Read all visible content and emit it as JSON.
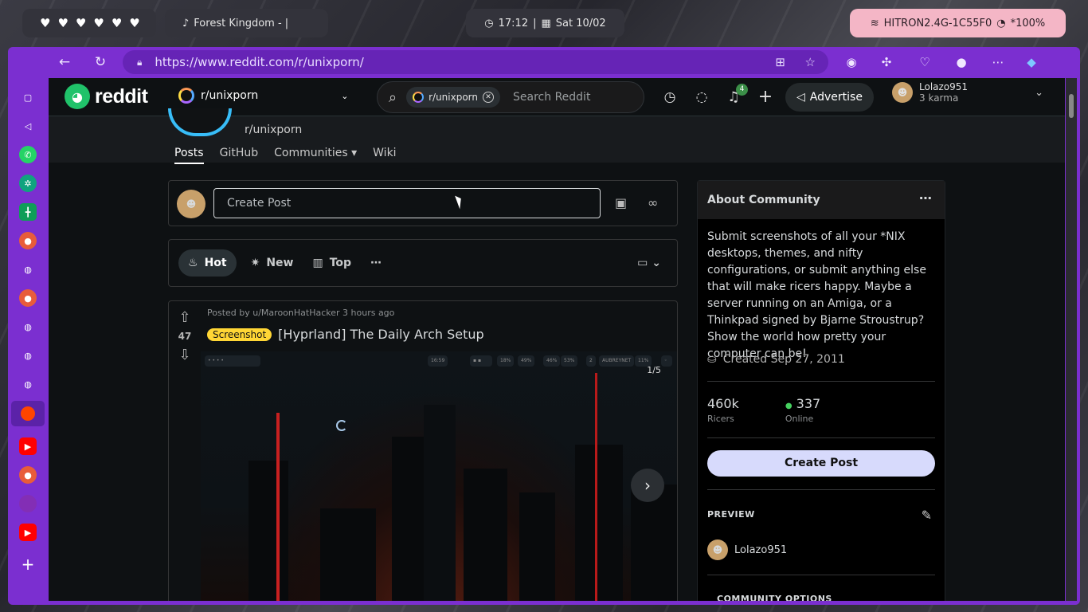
{
  "topbar": {
    "hearts": [
      "♥",
      "♥",
      "♥",
      "♥",
      "♥",
      "♥"
    ],
    "media_title": "Forest Kingdom -  |",
    "time": "17:12",
    "date": "Sat 10/02",
    "wifi": "HITRON2.4G-1C55F0",
    "brightness": "*100%"
  },
  "browser": {
    "url": "https://www.reddit.com/r/unixporn/"
  },
  "reddit": {
    "logo_text": "reddit",
    "subreddit": "r/unixporn",
    "search_chip": "r/unixporn",
    "search_placeholder": "Search Reddit",
    "notif_count": "4",
    "advertise": "Advertise",
    "username": "Lolazo951",
    "karma": "3 karma"
  },
  "subheader": {
    "name": "r/unixporn",
    "tabs": [
      "Posts",
      "GitHub",
      "Communities",
      "Wiki"
    ]
  },
  "feed": {
    "create_placeholder": "Create Post",
    "sort": [
      "Hot",
      "New",
      "Top"
    ],
    "post": {
      "meta": "Posted by u/MaroonHatHacker 3 hours ago",
      "score": "47",
      "flair": "Screenshot",
      "title": "[Hyprland] The Daily Arch Setup",
      "counter": "1/5",
      "bar_items": [
        "16:59",
        "18%",
        "49%",
        "46%",
        "53%",
        "2",
        "AUBREYNET",
        "11%"
      ]
    }
  },
  "about": {
    "title": "About Community",
    "description": "Submit screenshots of all your *NIX desktops, themes, and nifty configurations, or submit anything else that will make ricers happy. Maybe a server running on an Amiga, or a Thinkpad signed by Bjarne Stroustrup? Show the world how pretty your computer can be!",
    "created": "Created Sep 27, 2011",
    "members": "460k",
    "members_label": "Ricers",
    "online": "337",
    "online_label": "Online",
    "create_post": "Create Post",
    "preview": "PREVIEW",
    "preview_user": "Lolazo951",
    "community_options": "COMMUNITY OPTIONS"
  }
}
